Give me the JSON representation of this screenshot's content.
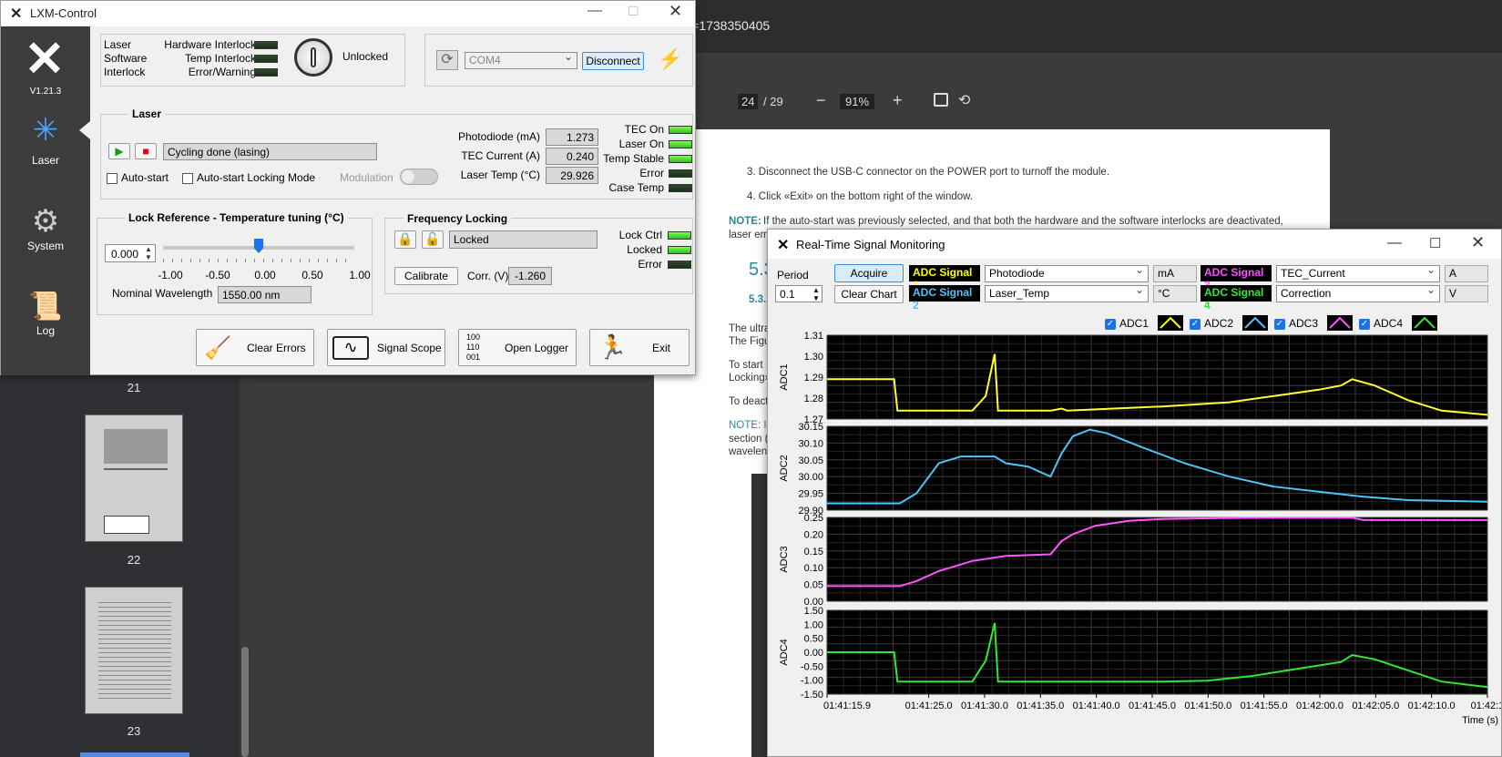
{
  "browser": {
    "url_fragment": "df?_t=1738350405",
    "page_current": "24",
    "page_total": "/ 29",
    "zoom": "91%",
    "zoom_minus": "−",
    "zoom_plus": "+"
  },
  "thumbs": [
    {
      "label": "21"
    },
    {
      "label": "22"
    },
    {
      "label": "23"
    }
  ],
  "pdf": {
    "item3": "3.     Disconnect the USB-C connector on the POWER port to turnoff the module.",
    "item4": "4.     Click «Exit» on the bottom right of the window.",
    "note_label": "NOTE:",
    "note_text": "If the auto-start was previously selected, and that both the hardware and the software interlocks are deactivated,",
    "laser_em": "laser em",
    "h53": "5.3",
    "h531": "5.3.",
    "p1a": "The ultra",
    "p1b": "The Figu",
    "p2a": "To start",
    "p2b": "Locking»",
    "p3": "To deact",
    "note2": "NOTE: In",
    "p4a": "section (",
    "p4b": "waveleng"
  },
  "lxm": {
    "title": "LXM-Control",
    "version": "V1.21.3",
    "side": [
      {
        "label": "Laser"
      },
      {
        "label": "System"
      },
      {
        "label": "Log"
      }
    ],
    "interlock": {
      "col1": [
        "Laser",
        "Software",
        "Interlock"
      ],
      "col2": [
        "Hardware Interlock",
        "Temp Interlock",
        "Error/Warning"
      ],
      "status": "Unlocked"
    },
    "com": {
      "port": "COM4",
      "disconnect": "Disconnect"
    },
    "laser": {
      "section": "Laser",
      "status": "Cycling done (lasing)",
      "autostart": "Auto-start",
      "autostart_lock": "Auto-start Locking Mode",
      "modulation": "Modulation",
      "readouts": [
        {
          "label": "Photodiode (mA)",
          "value": "1.273"
        },
        {
          "label": "TEC Current (A)",
          "value": "0.240"
        },
        {
          "label": "Laser Temp (°C)",
          "value": "29.926"
        }
      ],
      "leds": [
        {
          "label": "TEC On",
          "on": true
        },
        {
          "label": "Laser On",
          "on": true
        },
        {
          "label": "Temp Stable",
          "on": true
        },
        {
          "label": "Error",
          "on": false
        },
        {
          "label": "Case Temp",
          "on": false
        }
      ]
    },
    "lockref": {
      "section": "Lock Reference - Temperature tuning (°C)",
      "value": "0.000",
      "ticks": [
        "-1.00",
        "-0.50",
        "0.00",
        "0.50",
        "1.00"
      ],
      "slider_fraction": 0.5,
      "nominal_label": "Nominal Wavelength",
      "nominal_value": "1550.00 nm"
    },
    "freq": {
      "section": "Frequency Locking",
      "status": "Locked",
      "calibrate": "Calibrate",
      "corr_label": "Corr. (V)",
      "corr_value": "-1.260",
      "leds": [
        {
          "label": "Lock Ctrl",
          "on": true
        },
        {
          "label": "Locked",
          "on": true
        },
        {
          "label": "Error",
          "on": false
        }
      ]
    },
    "buttons": {
      "clear": "Clear Errors",
      "scope": "Signal Scope",
      "logger": "Open Logger",
      "exit": "Exit"
    }
  },
  "rt": {
    "title": "Real-Time Signal Monitoring",
    "period_label": "Period",
    "period_value": "0.1",
    "acquire": "Acquire",
    "clear": "Clear Chart",
    "signals": [
      {
        "tag": "ADC Signal 1",
        "source": "Photodiode",
        "unit": "mA",
        "color": "#ffff00"
      },
      {
        "tag": "ADC Signal 2",
        "source": "Laser_Temp",
        "unit": "°C",
        "color": "#4fc3f7"
      },
      {
        "tag": "ADC Signal 3",
        "source": "TEC_Current",
        "unit": "A",
        "color": "#ff4fff"
      },
      {
        "tag": "ADC Signal 4",
        "source": "Correction",
        "unit": "V",
        "color": "#33e633"
      }
    ],
    "legend": [
      "ADC1",
      "ADC2",
      "ADC3",
      "ADC4"
    ]
  },
  "chart_data": {
    "type": "line",
    "xlabel": "Time (s)",
    "x_ticks": [
      "01:41:15.9",
      "01:41:25.0",
      "01:41:30.0",
      "01:41:35.0",
      "01:41:40.0",
      "01:41:45.0",
      "01:41:50.0",
      "01:41:55.0",
      "01:42:00.0",
      "01:42:05.0",
      "01:42:10.0",
      "01:42:1"
    ],
    "x_tick_seconds": [
      0,
      9.1,
      14.1,
      19.1,
      24.1,
      29.1,
      34.1,
      39.1,
      44.1,
      49.1,
      54.1,
      59.1
    ],
    "xlim": [
      0,
      59.1
    ],
    "grid": true,
    "panels": [
      {
        "ylabel": "ADC1",
        "ylim": [
          1.27,
          1.31
        ],
        "y_ticks": [
          "1.31",
          "1.30",
          "1.29",
          "1.28",
          "1.27"
        ],
        "color": "#ffff33",
        "x": [
          0,
          6,
          6.3,
          13,
          14.2,
          15.0,
          15.3,
          20,
          21,
          21.5,
          30,
          36,
          40,
          44,
          46,
          47,
          49,
          52,
          55,
          59.1
        ],
        "y": [
          1.289,
          1.289,
          1.274,
          1.274,
          1.281,
          1.301,
          1.274,
          1.274,
          1.275,
          1.274,
          1.276,
          1.278,
          1.281,
          1.284,
          1.286,
          1.289,
          1.286,
          1.279,
          1.274,
          1.272
        ]
      },
      {
        "ylabel": "ADC2",
        "ylim": [
          29.9,
          30.15
        ],
        "y_ticks": [
          "30.15",
          "30.10",
          "30.05",
          "30.00",
          "29.95",
          "29.90"
        ],
        "color": "#4fc3f7",
        "x": [
          0,
          6.5,
          8,
          10,
          12,
          15,
          16,
          18,
          20,
          21,
          22,
          23.5,
          25,
          28,
          32,
          36,
          40,
          44,
          48,
          52,
          59.1
        ],
        "y": [
          29.92,
          29.92,
          29.95,
          30.04,
          30.06,
          30.06,
          30.04,
          30.03,
          30.0,
          30.07,
          30.12,
          30.14,
          30.13,
          30.09,
          30.04,
          30.0,
          29.97,
          29.955,
          29.94,
          29.93,
          29.925
        ]
      },
      {
        "ylabel": "ADC3",
        "ylim": [
          0,
          0.25
        ],
        "y_ticks": [
          "0.25",
          "0.20",
          "0.15",
          "0.10",
          "0.05",
          "0.00"
        ],
        "color": "#ff55ff",
        "x": [
          0,
          6.5,
          8,
          10,
          13,
          16,
          20,
          21,
          22,
          24,
          27,
          30,
          35,
          40,
          47,
          48,
          59.1
        ],
        "y": [
          0.045,
          0.045,
          0.06,
          0.09,
          0.12,
          0.135,
          0.14,
          0.18,
          0.2,
          0.225,
          0.24,
          0.245,
          0.248,
          0.249,
          0.249,
          0.242,
          0.242
        ]
      },
      {
        "ylabel": "ADC4",
        "ylim": [
          -1.5,
          1.5
        ],
        "y_ticks": [
          "1.50",
          "1.00",
          "0.50",
          "0.00",
          "-0.50",
          "-1.00",
          "-1.50"
        ],
        "color": "#33e633",
        "x": [
          0,
          6,
          6.3,
          13,
          14.2,
          15.0,
          15.3,
          30,
          34,
          38,
          42,
          46,
          47,
          49,
          52,
          55,
          59.1
        ],
        "y": [
          0,
          0,
          -1.05,
          -1.05,
          -0.3,
          1.05,
          -1.05,
          -1.05,
          -1.02,
          -0.85,
          -0.6,
          -0.35,
          -0.1,
          -0.25,
          -0.65,
          -1.05,
          -1.25
        ]
      }
    ]
  }
}
